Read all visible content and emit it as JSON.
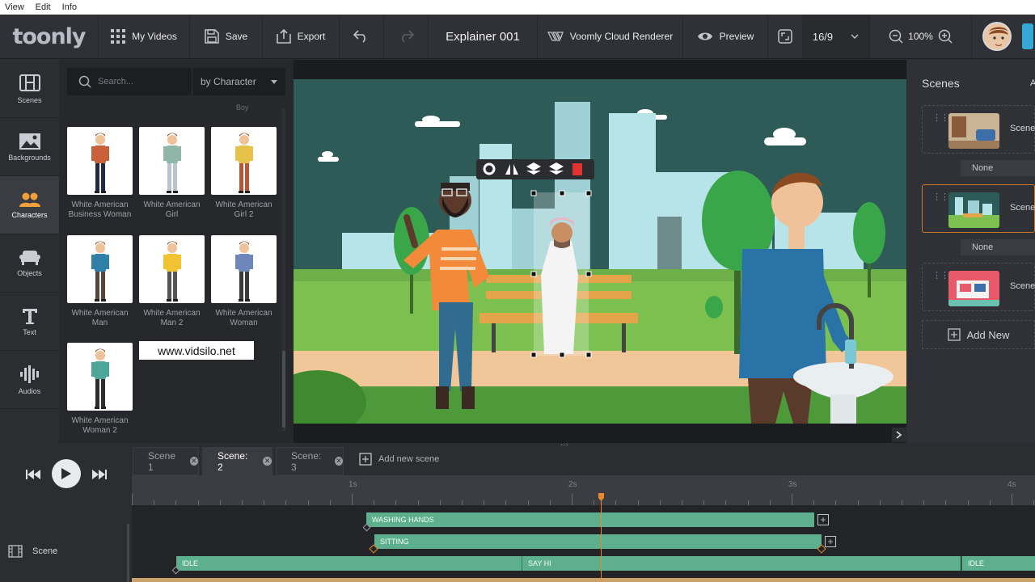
{
  "menu": {
    "view": "View",
    "edit": "Edit",
    "info": "Info"
  },
  "toolbar": {
    "logo": "toonly",
    "my_videos": "My Videos",
    "save": "Save",
    "export": "Export",
    "project_title": "Explainer 001",
    "renderer": "Voomly Cloud Renderer",
    "preview": "Preview",
    "aspect_ratio": "16/9",
    "zoom": "100%"
  },
  "iconbar": {
    "items": [
      {
        "label": "Scenes",
        "icon": "scenes-icon"
      },
      {
        "label": "Backgrounds",
        "icon": "backgrounds-icon"
      },
      {
        "label": "Characters",
        "icon": "characters-icon"
      },
      {
        "label": "Objects",
        "icon": "objects-icon"
      },
      {
        "label": "Text",
        "icon": "text-icon"
      },
      {
        "label": "Audios",
        "icon": "audios-icon"
      }
    ],
    "active": "Characters"
  },
  "library": {
    "search_placeholder": "Search...",
    "filter": "by Character",
    "partial_label": "Boy",
    "characters": [
      {
        "label": "White American Business Woman",
        "shirt": "#c8613a",
        "legs": "#1f2b48"
      },
      {
        "label": "White American Girl",
        "shirt": "#8fb6a8",
        "legs": "#b8c4d0"
      },
      {
        "label": "White American Girl 2",
        "shirt": "#e6c24a",
        "legs": "#b7573a"
      },
      {
        "label": "White American Man",
        "shirt": "#2f7fa6",
        "legs": "#5a4638"
      },
      {
        "label": "White American Man 2",
        "shirt": "#f1c232",
        "legs": "#555555"
      },
      {
        "label": "White American Woman",
        "shirt": "#6f87b8",
        "legs": "#3a3a3a"
      },
      {
        "label": "White American Woman 2",
        "shirt": "#4ea69a",
        "legs": "#2d2d2d"
      }
    ],
    "watermark": "www.vidsilo.net"
  },
  "canvas": {
    "object_toolbar": [
      "gear-icon",
      "flip-icon",
      "bring-forward-icon",
      "send-backward-icon",
      "delete-icon"
    ]
  },
  "scenes_panel": {
    "title": "Scenes",
    "title_extra": "A",
    "scenes": [
      {
        "name": "Scene",
        "transition": "None"
      },
      {
        "name": "Scene",
        "transition": "None"
      },
      {
        "name": "Scene"
      }
    ],
    "add_new": "Add New"
  },
  "timeline": {
    "tabs": [
      {
        "label": "Scene 1",
        "active": false
      },
      {
        "label": "Scene: 2",
        "active": true
      },
      {
        "label": "Scene: 3",
        "active": false
      }
    ],
    "add_new_scene": "Add new scene",
    "ruler_labels": [
      "1s",
      "2s",
      "3s",
      "4s"
    ],
    "track_label": "Scene",
    "tracks": {
      "washing_hands": "WASHING HANDS",
      "sitting": "SITTING",
      "idle_1": "IDLE",
      "say_hi": "SAY HI",
      "idle_2": "IDLE"
    }
  },
  "colors": {
    "accent": "#e8892f",
    "track_green": "#5eaf8e",
    "delete_red": "#e0322f"
  }
}
